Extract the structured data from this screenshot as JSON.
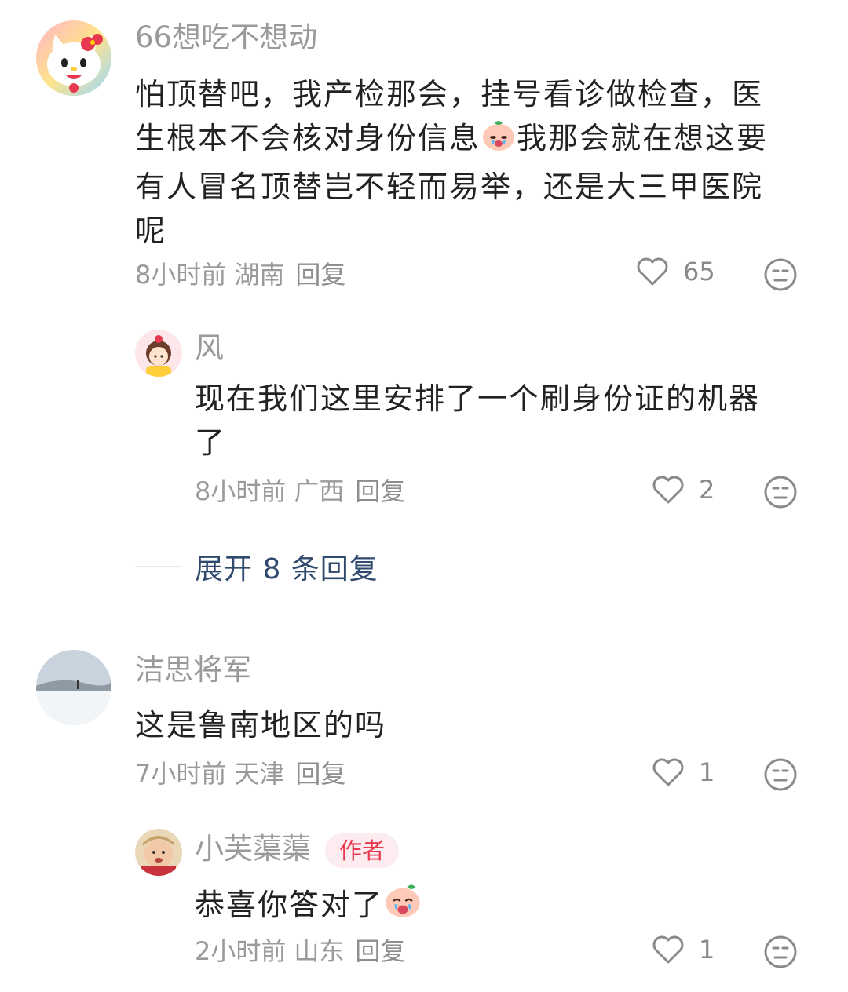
{
  "comments": [
    {
      "name": "66想吃不想动",
      "text_lines": [
        "怕顶替吧，我产检那会，挂号看诊做检查，医",
        "生根本不会核对身份信息",
        "我那会就在想这要",
        "有人冒名顶替岂不轻而易举，还是大三甲医院",
        "呢"
      ],
      "time": "8小时前",
      "region": "湖南",
      "reply": "回复",
      "likes": "65"
    },
    {
      "name": "风",
      "text_lines": [
        "现在我们这里安排了一个刷身份证的机器",
        "了"
      ],
      "time": "8小时前",
      "region": "广西",
      "reply": "回复",
      "likes": "2"
    },
    {
      "name": "洁思将军",
      "text_lines": [
        "这是鲁南地区的吗"
      ],
      "time": "7小时前",
      "region": "天津",
      "reply": "回复",
      "likes": "1"
    },
    {
      "name": "小芙蕖蕖",
      "badge": "作者",
      "text_lines": [
        "恭喜你答对了"
      ],
      "time": "2小时前",
      "region": "山东",
      "reply": "回复",
      "likes": "1"
    }
  ],
  "expand": {
    "label": "展开 8 条回复"
  },
  "colors": {
    "name": "#9a9a9a",
    "text": "#222222",
    "link": "#2f4a6d",
    "badge_bg": "#fdecef",
    "badge_text": "#e8384f"
  },
  "icons": [
    "heart-outline-icon",
    "neutral-face-icon",
    "crying-face-emoji",
    "crying-face-emoji"
  ]
}
